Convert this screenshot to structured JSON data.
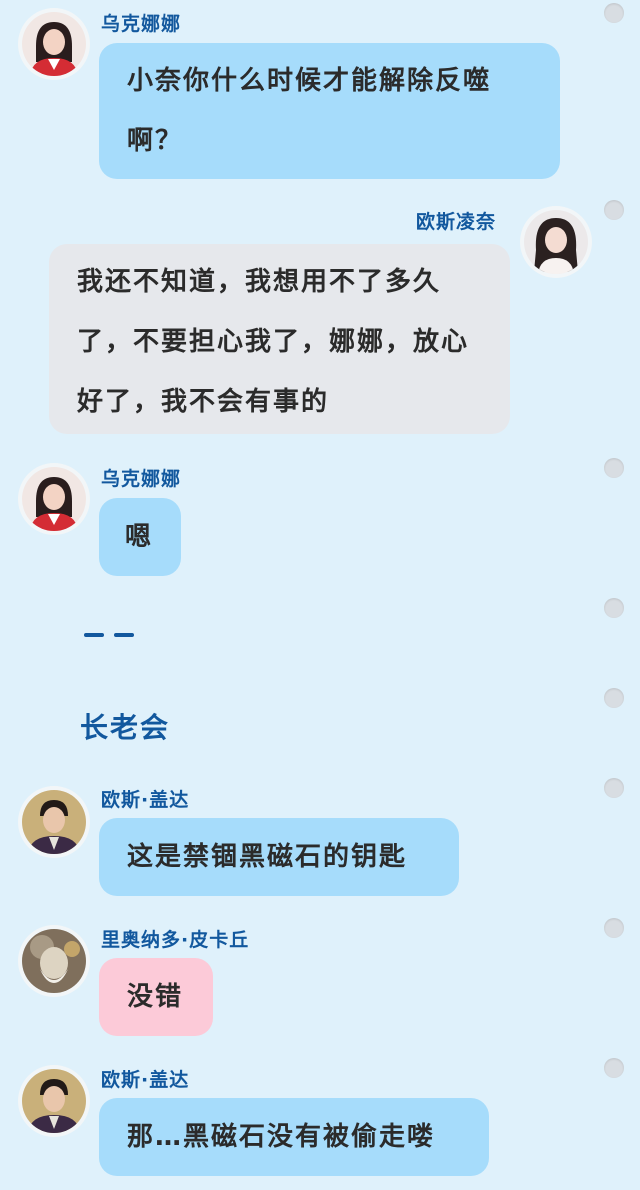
{
  "colors": {
    "accent": "#12589e",
    "blue_bubble": "#a6dcfb",
    "gray_bubble": "#e6e8ec",
    "pink_bubble": "#fccad8",
    "background": "#dff1fb"
  },
  "messages": [
    {
      "sender": "乌克娜娜",
      "text": "小奈你什么时候才能解除反噬啊？",
      "avatar": "nana-avatar",
      "side": "left",
      "bubble": "blue"
    },
    {
      "sender": "欧斯凌奈",
      "text": "我还不知道，我想用不了多久了，不要担心我了，娜娜，放心好了，我不会有事的",
      "avatar": "lingnai-avatar",
      "side": "right",
      "bubble": "gray"
    },
    {
      "sender": "乌克娜娜",
      "text": "嗯",
      "avatar": "nana-avatar",
      "side": "left",
      "bubble": "blue"
    }
  ],
  "separator": "——",
  "section_title": "长老会",
  "messages2": [
    {
      "sender": "欧斯·盖达",
      "text": "这是禁锢黑磁石的钥匙",
      "avatar": "gaida-avatar",
      "bubble": "blue"
    },
    {
      "sender": "里奥纳多·皮卡丘",
      "text": "没错",
      "avatar": "pikachu-elder-avatar",
      "bubble": "pink"
    },
    {
      "sender": "欧斯·盖达",
      "text": "那…黑磁石没有被偷走喽",
      "avatar": "gaida-avatar",
      "bubble": "blue"
    }
  ]
}
